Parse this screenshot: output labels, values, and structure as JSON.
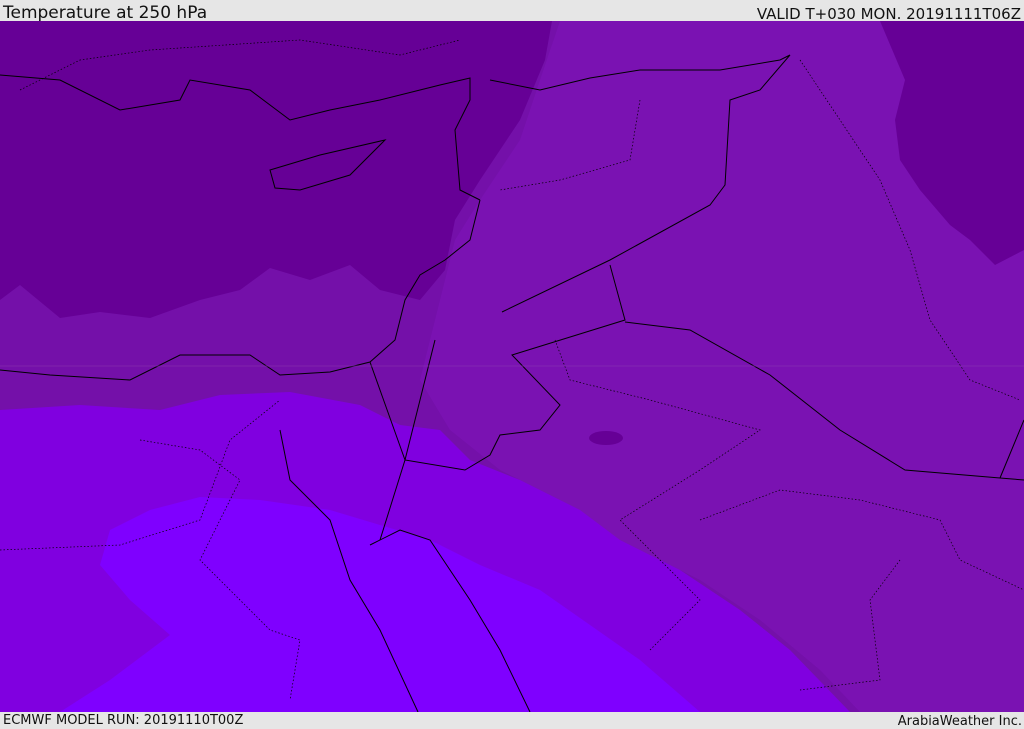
{
  "header": {
    "title": "Temperature at 250 hPa",
    "valid": "VALID T+030 MON. 20191111T06Z"
  },
  "footer": {
    "model_run": "ECMWF MODEL RUN: 20191110T00Z",
    "credit": "ArabiaWeather Inc."
  },
  "colors": {
    "coldest": "#660096",
    "cold": "#7410a9",
    "mid": "#7a12b2",
    "warm": "#8000e0",
    "warmest": "#7f00ff",
    "border": "#000000"
  }
}
